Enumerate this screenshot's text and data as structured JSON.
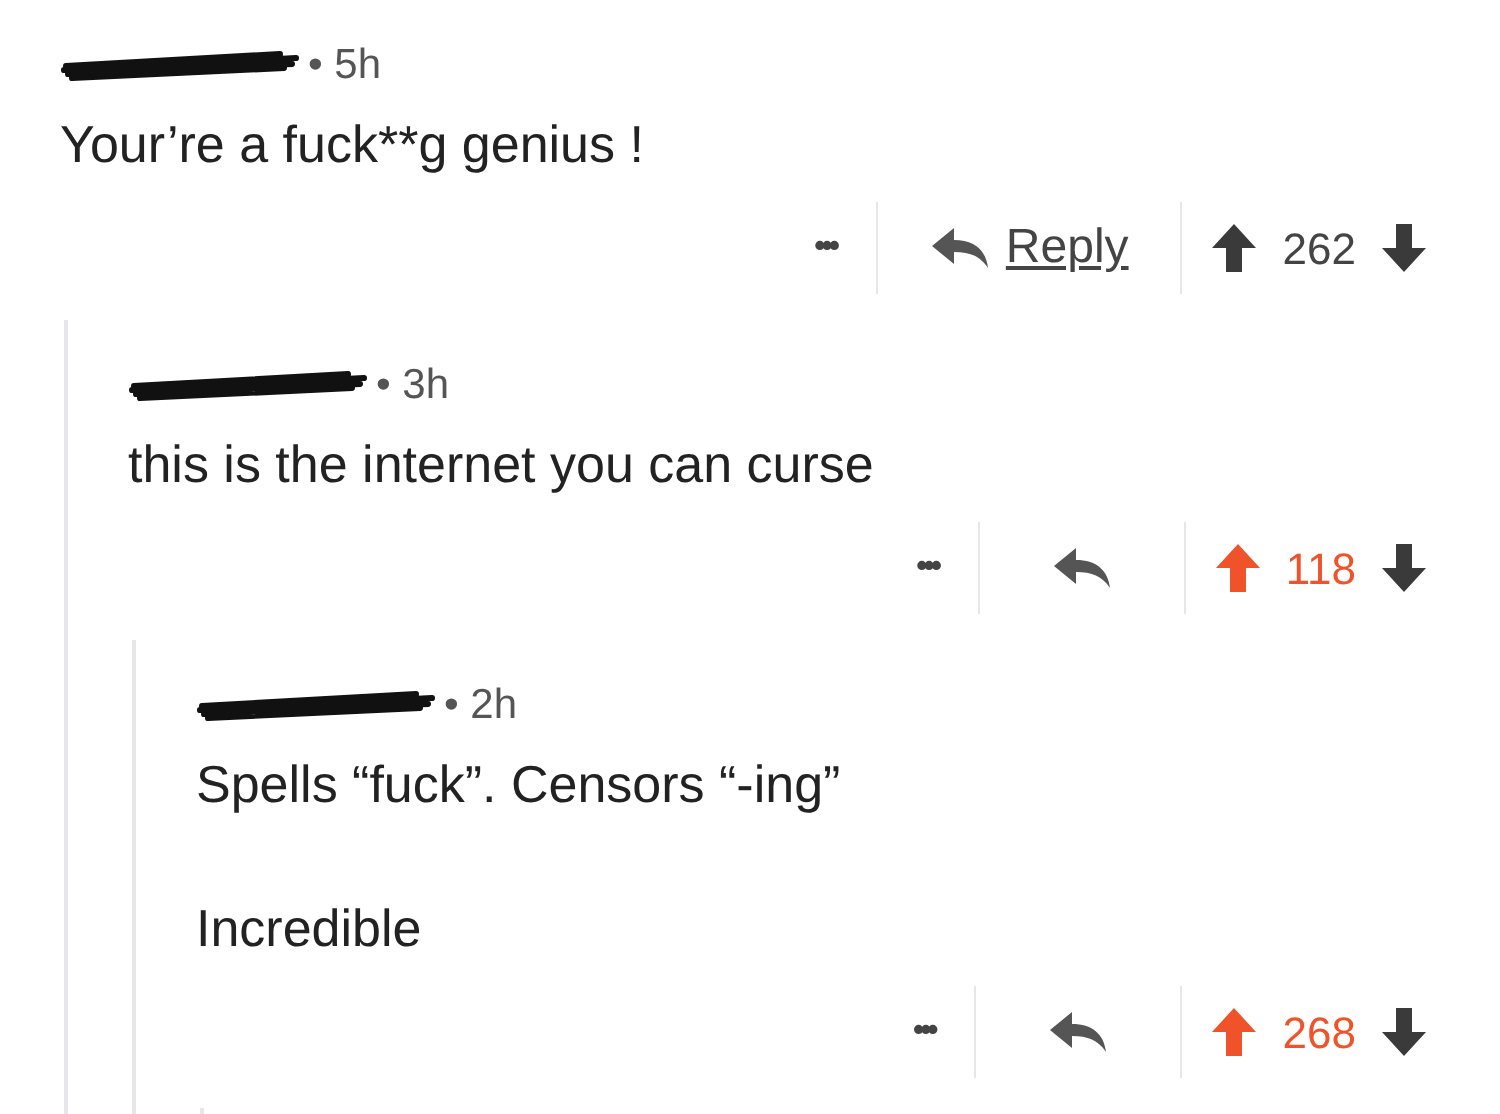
{
  "comments": [
    {
      "time": "• 5h",
      "body": [
        "Your’re a fuck**g genius !"
      ],
      "more": "•••",
      "reply_label": "Reply",
      "score": "262",
      "upvoted": false,
      "children": [
        {
          "time": "• 3h",
          "body": [
            "this is the internet you can curse"
          ],
          "more": "•••",
          "score": "118",
          "upvoted": true,
          "children": [
            {
              "time": "• 2h",
              "body": [
                "Spells “fuck”. Censors “-ing”",
                "Incredible"
              ],
              "more": "•••",
              "score": "268",
              "upvoted": true,
              "replies_below": true
            }
          ]
        }
      ]
    }
  ]
}
